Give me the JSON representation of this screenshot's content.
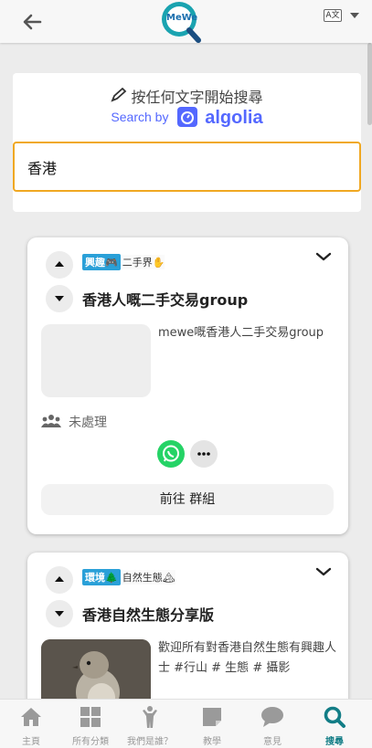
{
  "header": {
    "logo_text": "MeWe",
    "translate_label": "A文"
  },
  "search": {
    "hint": "按任何文字開始搜尋",
    "search_by": "Search by",
    "algolia": "algolia",
    "value": "香港"
  },
  "results": [
    {
      "tag_main": "興趣🎮",
      "tag_sub": "二手界✋",
      "title": "香港人嘅二手交易group",
      "description": "mewe嘅香港人二手交易group",
      "status": "未處理",
      "goto_label": "前往 群組"
    },
    {
      "tag_main": "環境🌲",
      "tag_sub": "自然生態🏔",
      "title": "香港自然生態分享版",
      "description": "歡迎所有對香港自然生態有興趣人士 #行山 # 生態 # 攝影"
    }
  ],
  "bottom_nav": {
    "items": [
      {
        "label": "主頁",
        "icon": "home-icon"
      },
      {
        "label": "所有分類",
        "icon": "grid-icon"
      },
      {
        "label": "我們是誰？",
        "icon": "person-icon"
      },
      {
        "label": "教學",
        "icon": "note-icon"
      },
      {
        "label": "意見",
        "icon": "chat-icon"
      },
      {
        "label": "搜尋",
        "icon": "search-icon"
      }
    ],
    "active_index": 5
  },
  "colors": {
    "accent": "#127d86",
    "input_border": "#f0a822",
    "algolia": "#5468ff",
    "whatsapp": "#25d366",
    "tag_badge": "#2aa0d8"
  }
}
